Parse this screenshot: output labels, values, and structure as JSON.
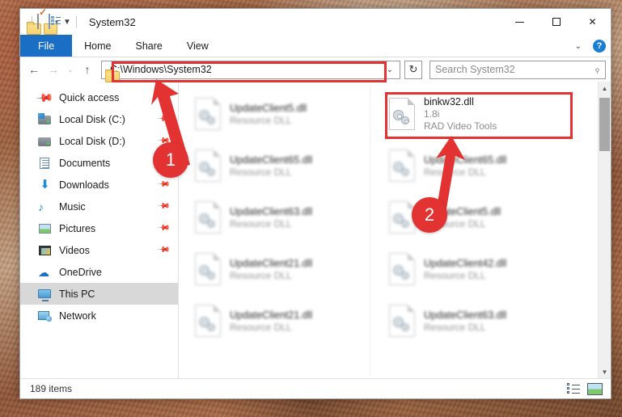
{
  "window": {
    "title": "System32",
    "quick_access_toolbar": [
      {
        "name": "folder-icon",
        "label": "Properties menu"
      },
      {
        "name": "properties-icon",
        "label": "Properties"
      },
      {
        "name": "new-folder-icon",
        "label": "New folder"
      },
      {
        "name": "customize-view-icon",
        "label": "Customize Quick Access Toolbar"
      }
    ],
    "controls": {
      "minimize": "Minimize",
      "maximize": "Maximize",
      "close": "Close"
    }
  },
  "ribbon": {
    "tabs": [
      {
        "label": "File",
        "selected": true
      },
      {
        "label": "Home",
        "selected": false
      },
      {
        "label": "Share",
        "selected": false
      },
      {
        "label": "View",
        "selected": false
      }
    ],
    "expand_label": "Expand the Ribbon",
    "help_label": "?"
  },
  "navigation": {
    "back": "Back",
    "forward": "Forward",
    "recent": "Recent locations",
    "up": "Up"
  },
  "address": {
    "path": "C:\\Windows\\System32",
    "dropdown": "Previous locations",
    "refresh": "↻"
  },
  "search": {
    "placeholder": "Search System32",
    "icon": "search-icon"
  },
  "sidebar": {
    "items": [
      {
        "label": "Quick access",
        "icon": "pin-icon",
        "pinned": false,
        "selected": false
      },
      {
        "label": "Local Disk (C:)",
        "icon": "drive-windows-icon",
        "pinned": true,
        "selected": false
      },
      {
        "label": "Local Disk (D:)",
        "icon": "drive-icon",
        "pinned": true,
        "selected": false
      },
      {
        "label": "Documents",
        "icon": "documents-icon",
        "pinned": true,
        "selected": false
      },
      {
        "label": "Downloads",
        "icon": "downloads-icon",
        "pinned": true,
        "selected": false
      },
      {
        "label": "Music",
        "icon": "music-icon",
        "pinned": true,
        "selected": false
      },
      {
        "label": "Pictures",
        "icon": "pictures-icon",
        "pinned": true,
        "selected": false
      },
      {
        "label": "Videos",
        "icon": "videos-icon",
        "pinned": true,
        "selected": false
      },
      {
        "label": "OneDrive",
        "icon": "onedrive-icon",
        "pinned": false,
        "selected": false
      },
      {
        "label": "This PC",
        "icon": "this-pc-icon",
        "pinned": false,
        "selected": true
      },
      {
        "label": "Network",
        "icon": "network-icon",
        "pinned": false,
        "selected": false
      }
    ]
  },
  "files": {
    "column_left": [
      {
        "name": "UpdateClient5.dll",
        "version": "",
        "description": "Resource DLL",
        "blurred": true
      },
      {
        "name": "UpdateClient65.dll",
        "version": "",
        "description": "Resource DLL",
        "blurred": true
      },
      {
        "name": "UpdateClient63.dll",
        "version": "",
        "description": "Resource DLL",
        "blurred": true
      },
      {
        "name": "UpdateClient21.dll",
        "version": "",
        "description": "Resource DLL",
        "blurred": true
      },
      {
        "name": "UpdateClient21.dll",
        "version": "",
        "description": "Resource DLL",
        "blurred": true
      }
    ],
    "column_right": [
      {
        "name": "binkw32.dll",
        "version": "1.8i",
        "description": "RAD Video Tools",
        "blurred": false,
        "highlighted": true
      },
      {
        "name": "UpdateClient65.dll",
        "version": "",
        "description": "Resource DLL",
        "blurred": true
      },
      {
        "name": "UpdateClient5.dll",
        "version": "",
        "description": "Resource DLL",
        "blurred": true
      },
      {
        "name": "UpdateClient42.dll",
        "version": "",
        "description": "Resource DLL",
        "blurred": true
      },
      {
        "name": "UpdateClient63.dll",
        "version": "",
        "description": "Resource DLL",
        "blurred": true
      }
    ]
  },
  "status": {
    "item_count": "189 items",
    "views": [
      {
        "name": "details-view-button",
        "label": "Details view"
      },
      {
        "name": "large-icons-view-button",
        "label": "Large icons view"
      }
    ]
  },
  "annotations": {
    "accent_color": "#e23232",
    "markers": [
      {
        "number": "1",
        "target": "address-bar"
      },
      {
        "number": "2",
        "target": "binkw32-dll-file"
      }
    ]
  },
  "scrollbar": {
    "up": "▲",
    "down": "▼"
  }
}
